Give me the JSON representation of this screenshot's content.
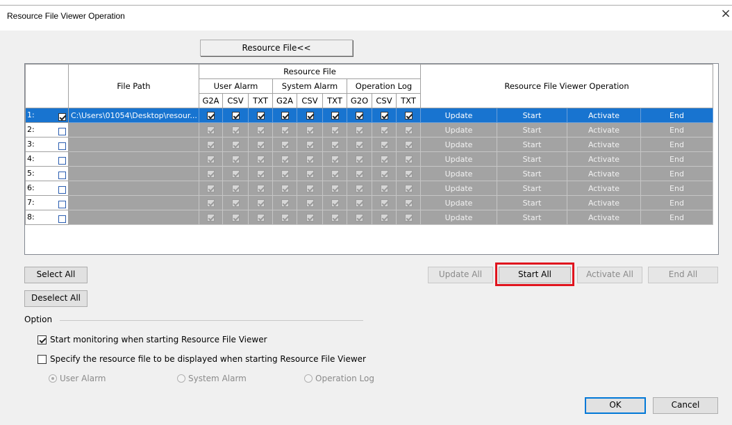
{
  "window": {
    "title": "Resource File Viewer Operation",
    "close_glyph": "×"
  },
  "resource_button_label": "Resource File<<",
  "grid": {
    "headers": {
      "file_path": "File Path",
      "resource_file": "Resource File",
      "user_alarm": "User Alarm",
      "system_alarm": "System Alarm",
      "operation_log": "Operation Log",
      "operation": "Resource File Viewer Operation",
      "sub": [
        "G2A",
        "CSV",
        "TXT",
        "G2A",
        "CSV",
        "TXT",
        "G2O",
        "CSV",
        "TXT"
      ]
    },
    "rows": [
      {
        "num": "1:",
        "checked": true,
        "path": "C:\\Users\\01054\\Desktop\\resour...",
        "flags": [
          true,
          true,
          true,
          true,
          true,
          true,
          true,
          true,
          true
        ],
        "update": "Update",
        "start": "Start",
        "activate": "Activate",
        "end": "End"
      },
      {
        "num": "2:",
        "checked": false,
        "path": "",
        "flags": [
          true,
          true,
          true,
          true,
          true,
          true,
          true,
          true,
          true
        ],
        "update": "Update",
        "start": "Start",
        "activate": "Activate",
        "end": "End"
      },
      {
        "num": "3:",
        "checked": false,
        "path": "",
        "flags": [
          true,
          true,
          true,
          true,
          true,
          true,
          true,
          true,
          true
        ],
        "update": "Update",
        "start": "Start",
        "activate": "Activate",
        "end": "End"
      },
      {
        "num": "4:",
        "checked": false,
        "path": "",
        "flags": [
          true,
          true,
          true,
          true,
          true,
          true,
          true,
          true,
          true
        ],
        "update": "Update",
        "start": "Start",
        "activate": "Activate",
        "end": "End"
      },
      {
        "num": "5:",
        "checked": false,
        "path": "",
        "flags": [
          true,
          true,
          true,
          true,
          true,
          true,
          true,
          true,
          true
        ],
        "update": "Update",
        "start": "Start",
        "activate": "Activate",
        "end": "End"
      },
      {
        "num": "6:",
        "checked": false,
        "path": "",
        "flags": [
          true,
          true,
          true,
          true,
          true,
          true,
          true,
          true,
          true
        ],
        "update": "Update",
        "start": "Start",
        "activate": "Activate",
        "end": "End"
      },
      {
        "num": "7:",
        "checked": false,
        "path": "",
        "flags": [
          true,
          true,
          true,
          true,
          true,
          true,
          true,
          true,
          true
        ],
        "update": "Update",
        "start": "Start",
        "activate": "Activate",
        "end": "End"
      },
      {
        "num": "8:",
        "checked": false,
        "path": "",
        "flags": [
          true,
          true,
          true,
          true,
          true,
          true,
          true,
          true,
          true
        ],
        "update": "Update",
        "start": "Start",
        "activate": "Activate",
        "end": "End"
      }
    ]
  },
  "buttons": {
    "select_all": "Select All",
    "deselect_all": "Deselect All",
    "update_all": "Update All",
    "start_all": "Start All",
    "activate_all": "Activate All",
    "end_all": "End All",
    "ok": "OK",
    "cancel": "Cancel"
  },
  "option": {
    "label": "Option",
    "start_monitoring": {
      "label": "Start monitoring when starting Resource File Viewer",
      "checked": true
    },
    "specify_file": {
      "label": "Specify the resource file to be displayed when starting Resource File Viewer",
      "checked": false
    },
    "radios": [
      {
        "label": "User Alarm",
        "selected": true
      },
      {
        "label": "System Alarm",
        "selected": false
      },
      {
        "label": "Operation Log",
        "selected": false
      }
    ]
  },
  "colors": {
    "selected_row": "#1874d0",
    "disabled_row": "#a3a3a3",
    "highlight": "#e0141e",
    "default_button_border": "#0078d7"
  }
}
